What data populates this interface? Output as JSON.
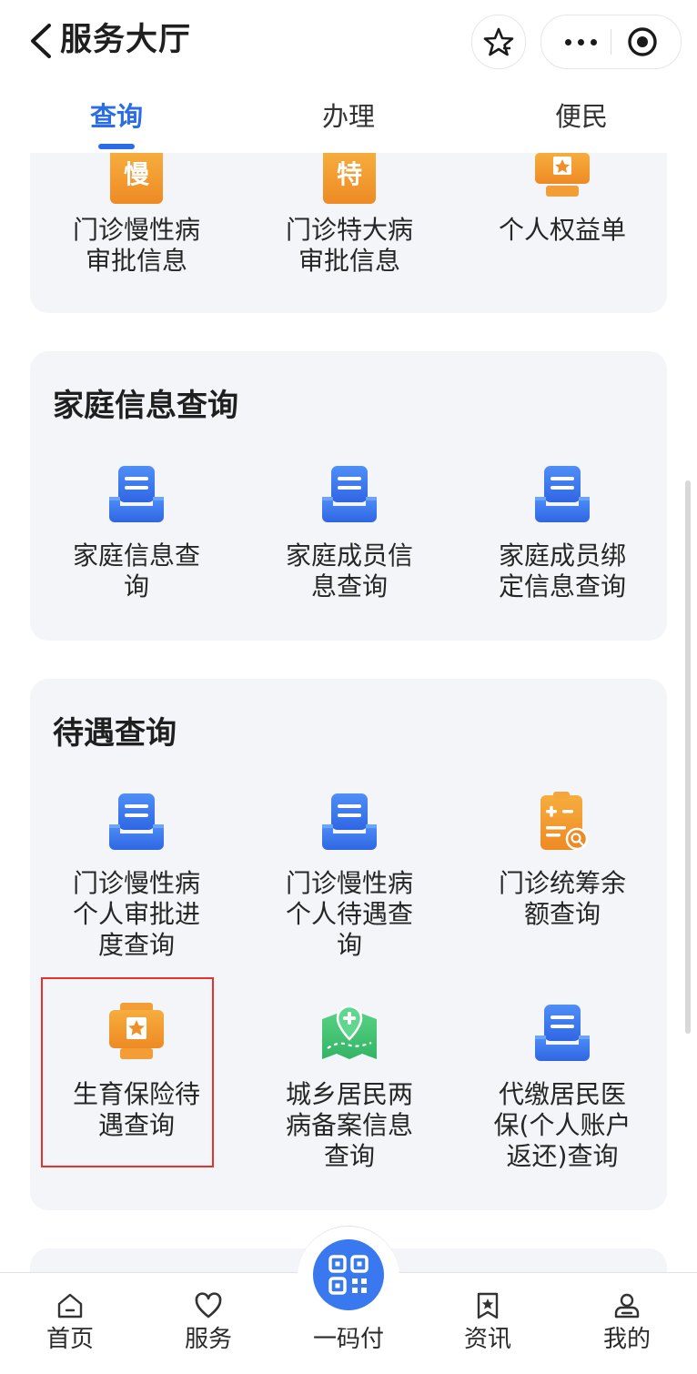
{
  "header": {
    "title": "服务大厅"
  },
  "tabs": [
    {
      "label": "查询",
      "active": true
    },
    {
      "label": "办理",
      "active": false
    },
    {
      "label": "便民",
      "active": false
    }
  ],
  "section1": {
    "items": [
      {
        "label_lines": [
          "门诊慢性病",
          "审批信息"
        ],
        "icon": "orange-badge-icon",
        "icon_char": "慢"
      },
      {
        "label_lines": [
          "门诊特大病",
          "审批信息"
        ],
        "icon": "orange-badge-icon",
        "icon_char": "特"
      },
      {
        "label_lines": [
          "个人权益单"
        ],
        "icon": "orange-certificate-icon"
      }
    ]
  },
  "section2": {
    "title": "家庭信息查询",
    "items": [
      {
        "label_lines": [
          "家庭信息查",
          "询"
        ],
        "icon": "blue-document-tray-icon"
      },
      {
        "label_lines": [
          "家庭成员信",
          "息查询"
        ],
        "icon": "blue-document-tray-icon"
      },
      {
        "label_lines": [
          "家庭成员绑",
          "定信息查询"
        ],
        "icon": "blue-document-tray-icon"
      }
    ]
  },
  "section3": {
    "title": "待遇查询",
    "items": [
      {
        "label_lines": [
          "门诊慢性病",
          "个人审批进",
          "度查询"
        ],
        "icon": "blue-document-tray-icon"
      },
      {
        "label_lines": [
          "门诊慢性病",
          "个人待遇查",
          "询"
        ],
        "icon": "blue-document-tray-icon"
      },
      {
        "label_lines": [
          "门诊统筹余",
          "额查询"
        ],
        "icon": "orange-calculator-search-icon"
      },
      {
        "label_lines": [
          "生育保险待",
          "遇查询"
        ],
        "icon": "orange-certificate-icon",
        "highlighted": true
      },
      {
        "label_lines": [
          "城乡居民两",
          "病备案信息",
          "查询"
        ],
        "icon": "green-map-pin-icon"
      },
      {
        "label_lines": [
          "代缴居民医",
          "保(个人账户",
          "返还)查询"
        ],
        "icon": "blue-document-tray-icon"
      }
    ]
  },
  "tabbar": {
    "items": [
      {
        "label": "首页",
        "icon": "home-icon"
      },
      {
        "label": "服务",
        "icon": "heart-icon"
      },
      {
        "label": "一码付",
        "icon": "qr-code-icon"
      },
      {
        "label": "资讯",
        "icon": "bookmark-star-icon"
      },
      {
        "label": "我的",
        "icon": "user-icon"
      }
    ]
  },
  "colors": {
    "accent": "#2b6de6",
    "orange": "#f19a2e",
    "blue": "#3a78ef",
    "green": "#3fc173",
    "card_bg": "#f4f5f8",
    "highlight_border": "#e8302f"
  }
}
